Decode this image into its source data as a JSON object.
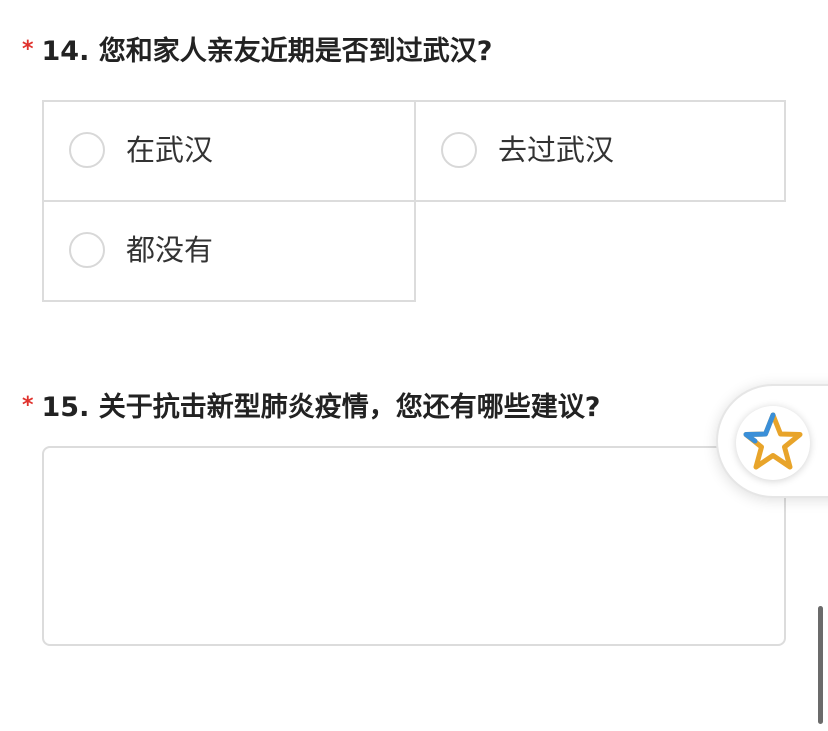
{
  "questions": [
    {
      "required_mark": "*",
      "title": "14. 您和家人亲友近期是否到过武汉?",
      "options": [
        "在武汉",
        "去过武汉",
        "都没有"
      ]
    },
    {
      "required_mark": "*",
      "title": "15. 关于抗击新型肺炎疫情，您还有哪些建议?",
      "answer_value": ""
    }
  ],
  "float_widget": {
    "icon": "star-icon"
  },
  "colors": {
    "required": "#e0322d",
    "border": "#dcdcdc",
    "text": "#333333",
    "star_gold": "#e8a42a",
    "star_blue": "#3a8fd8"
  }
}
